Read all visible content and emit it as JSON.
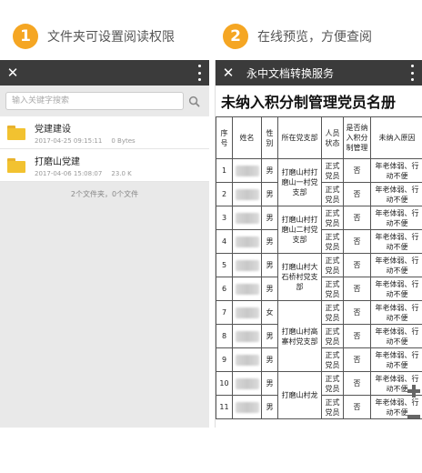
{
  "step1": {
    "number": "1",
    "text": "文件夹可设置阅读权限"
  },
  "step2": {
    "number": "2",
    "text": "在线预览，方便查阅"
  },
  "left": {
    "search_placeholder": "输入关键字搜索",
    "files": [
      {
        "name": "党建建设",
        "date": "2017-04-25 09:15:11",
        "size": "0 Bytes"
      },
      {
        "name": "打磨山党建",
        "date": "2017-04-06 15:08:07",
        "size": "23.0 K"
      }
    ],
    "summary": "2个文件夹，0个文件"
  },
  "right": {
    "title": "永中文档转换服务",
    "doc_title": "未纳入积分制管理党员名册",
    "headers": [
      "序号",
      "姓名",
      "性别",
      "所在党支部",
      "人员状态",
      "是否纳入积分制管理",
      "未纳入原因"
    ],
    "rows": [
      {
        "no": "1",
        "gender": "男",
        "status": "正式党员",
        "included": "否",
        "reason": "年老体弱、行动不便"
      },
      {
        "no": "2",
        "gender": "男",
        "status": "正式党员",
        "included": "否",
        "reason": "年老体弱、行动不便"
      },
      {
        "no": "3",
        "gender": "男",
        "status": "正式党员",
        "included": "否",
        "reason": "年老体弱、行动不便"
      },
      {
        "no": "4",
        "gender": "男",
        "status": "正式党员",
        "included": "否",
        "reason": "年老体弱、行动不便"
      },
      {
        "no": "5",
        "gender": "男",
        "status": "正式党员",
        "included": "否",
        "reason": "年老体弱、行动不便"
      },
      {
        "no": "6",
        "gender": "男",
        "status": "正式党员",
        "included": "否",
        "reason": "年老体弱、行动不便"
      },
      {
        "no": "7",
        "gender": "女",
        "status": "正式党员",
        "included": "否",
        "reason": "年老体弱、行动不便"
      },
      {
        "no": "8",
        "gender": "男",
        "status": "正式党员",
        "included": "否",
        "reason": "年老体弱、行动不便"
      },
      {
        "no": "9",
        "gender": "男",
        "status": "正式党员",
        "included": "否",
        "reason": "年老体弱、行动不便"
      },
      {
        "no": "10",
        "gender": "男",
        "status": "正式党员",
        "included": "否",
        "reason": "年老体弱、行动不便"
      },
      {
        "no": "11",
        "gender": "男",
        "status": "正式党员",
        "included": "否",
        "reason": "年老体弱、行动不便"
      }
    ],
    "branches": {
      "b1": "打磨山村打磨山一村党支部",
      "b2": "打磨山村打磨山二村党支部",
      "b3": "打磨山村大石桥村党支部",
      "b4": "打磨山村高寨村党支部",
      "b5": "打磨山村龙"
    }
  },
  "colors": {
    "accent": "#f5a623",
    "appbar": "#3b3b3b",
    "folder": "#f2c230"
  },
  "icons": {
    "close": "close-icon",
    "menu": "more-vert-icon",
    "search": "search-icon",
    "folder": "folder-icon",
    "zoom_in": "zoom-in-icon",
    "zoom_out": "zoom-out-icon"
  }
}
